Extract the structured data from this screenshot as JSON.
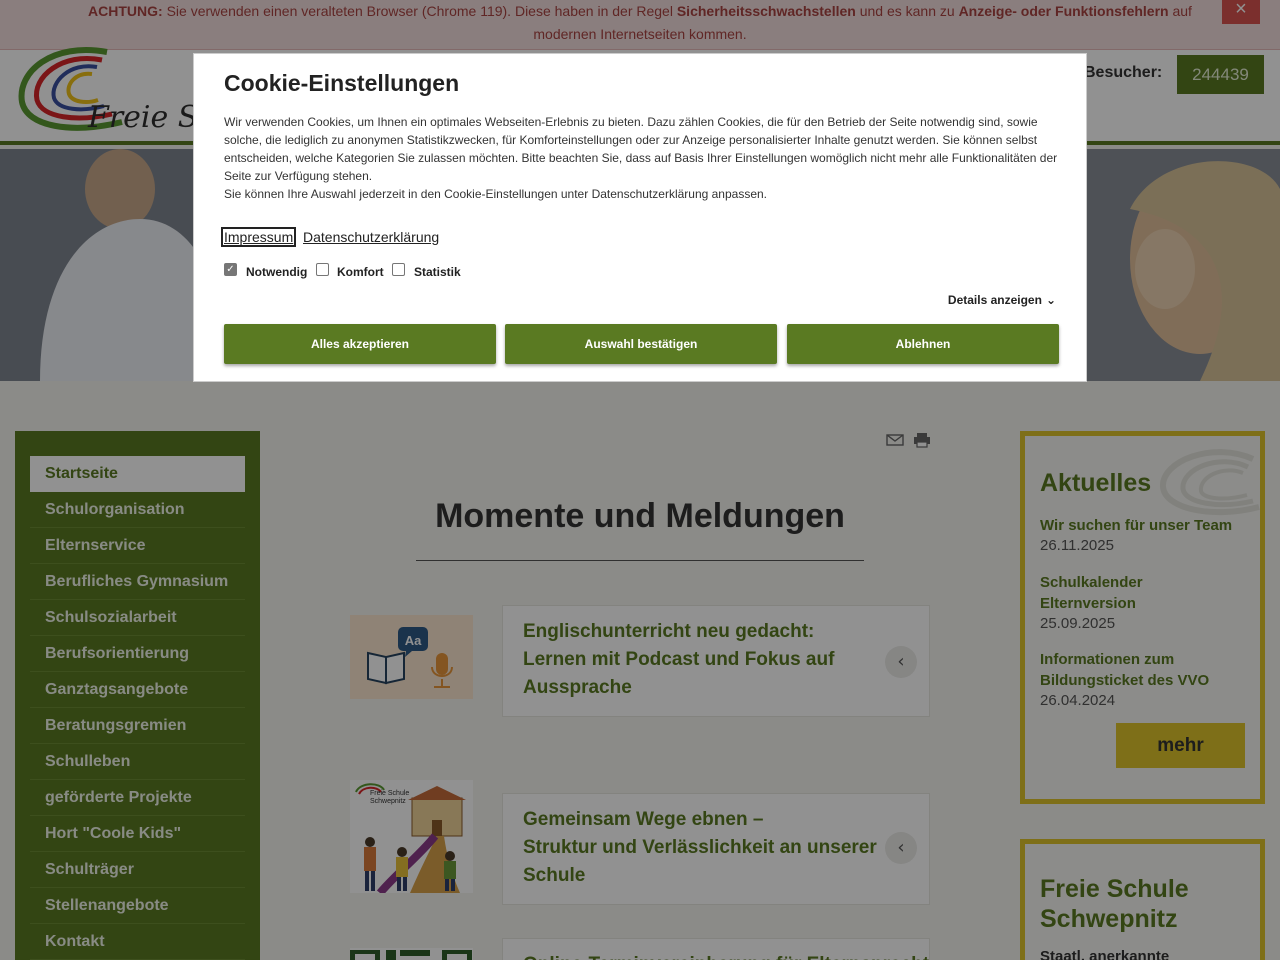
{
  "warning": {
    "prefix": "ACHTUNG:",
    "text1": "Sie verwenden einen veralteten Browser (Chrome 119). Diese haben in der Regel",
    "bold1": "Sicherheitsschwachstellen",
    "text2": "und es kann zu",
    "bold2": "Anzeige- oder Funktionsfehlern",
    "text3": "auf modernen Internetseiten kommen.",
    "close": "×"
  },
  "header": {
    "logo_text": "Freie Sc",
    "visitor_label": "Besucher:",
    "visitor_count": "244439"
  },
  "sidebar": {
    "items": [
      {
        "label": "Startseite"
      },
      {
        "label": "Schulorganisation"
      },
      {
        "label": "Elternservice"
      },
      {
        "label": "Berufliches Gymnasium"
      },
      {
        "label": "Schulsozialarbeit"
      },
      {
        "label": "Berufsorientierung"
      },
      {
        "label": "Ganztagsangebote"
      },
      {
        "label": "Beratungsgremien"
      },
      {
        "label": "Schulleben"
      },
      {
        "label": "geförderte Projekte"
      },
      {
        "label": "Hort \"Coole Kids\""
      },
      {
        "label": "Schulträger"
      },
      {
        "label": "Stellenangebote"
      },
      {
        "label": "Kontakt"
      }
    ]
  },
  "main": {
    "title": "Momente und Meldungen",
    "news": [
      {
        "lines": [
          "Englischunterricht neu gedacht:",
          "Lernen mit Podcast und Fokus auf",
          "Aussprache"
        ]
      },
      {
        "lines": [
          "Gemeinsam Wege ebnen –",
          "Struktur und Verlässlichkeit an unserer",
          "Schule"
        ]
      },
      {
        "lines": [
          "Online-Terminvereinbarung für Elternsprechtag"
        ]
      }
    ],
    "thumb2_caption": "Freie Schule\nSchwepnitz"
  },
  "aktuelles": {
    "title": "Aktuelles",
    "items": [
      {
        "title": "Wir suchen für unser Team",
        "date": "26.11.2025"
      },
      {
        "title": "Schulkalender Elternversion",
        "date": "25.09.2025"
      },
      {
        "title": "Informationen zum Bildungsticket des VVO",
        "date": "26.04.2024"
      }
    ],
    "more": "mehr"
  },
  "school_box": {
    "title": "Freie Schule Schwepnitz",
    "subtitle": "Staatl. anerkannte"
  },
  "cookie": {
    "title": "Cookie-Einstellungen",
    "text1": "Wir verwenden Cookies, um Ihnen ein optimales Webseiten-Erlebnis zu bieten. Dazu zählen Cookies, die für den Betrieb der Seite notwendig sind, sowie solche, die lediglich zu anonymen Statistikzwecken, für Komforteinstellungen oder zur Anzeige personalisierter Inhalte genutzt werden. Sie können selbst entscheiden, welche Kategorien Sie zulassen möchten. Bitte beachten Sie, dass auf Basis Ihrer Einstellungen womöglich nicht mehr alle Funktionalitäten der Seite zur Verfügung stehen.",
    "text2": "Sie können Ihre Auswahl jederzeit in den Cookie-Einstellungen unter Datenschutzerklärung anpassen.",
    "link_impressum": "Impressum",
    "link_datenschutz": "Datenschutzerklärung",
    "categories": [
      {
        "label": "Notwendig",
        "checked": true
      },
      {
        "label": "Komfort",
        "checked": false
      },
      {
        "label": "Statistik",
        "checked": false
      }
    ],
    "details": "Details anzeigen",
    "btn_accept_all": "Alles akzeptieren",
    "btn_confirm": "Auswahl bestätigen",
    "btn_reject": "Ablehnen"
  },
  "colors": {
    "brand_green": "#5a7a22",
    "brand_yellow": "#ddc42b",
    "warning_bg": "#f2dede"
  }
}
